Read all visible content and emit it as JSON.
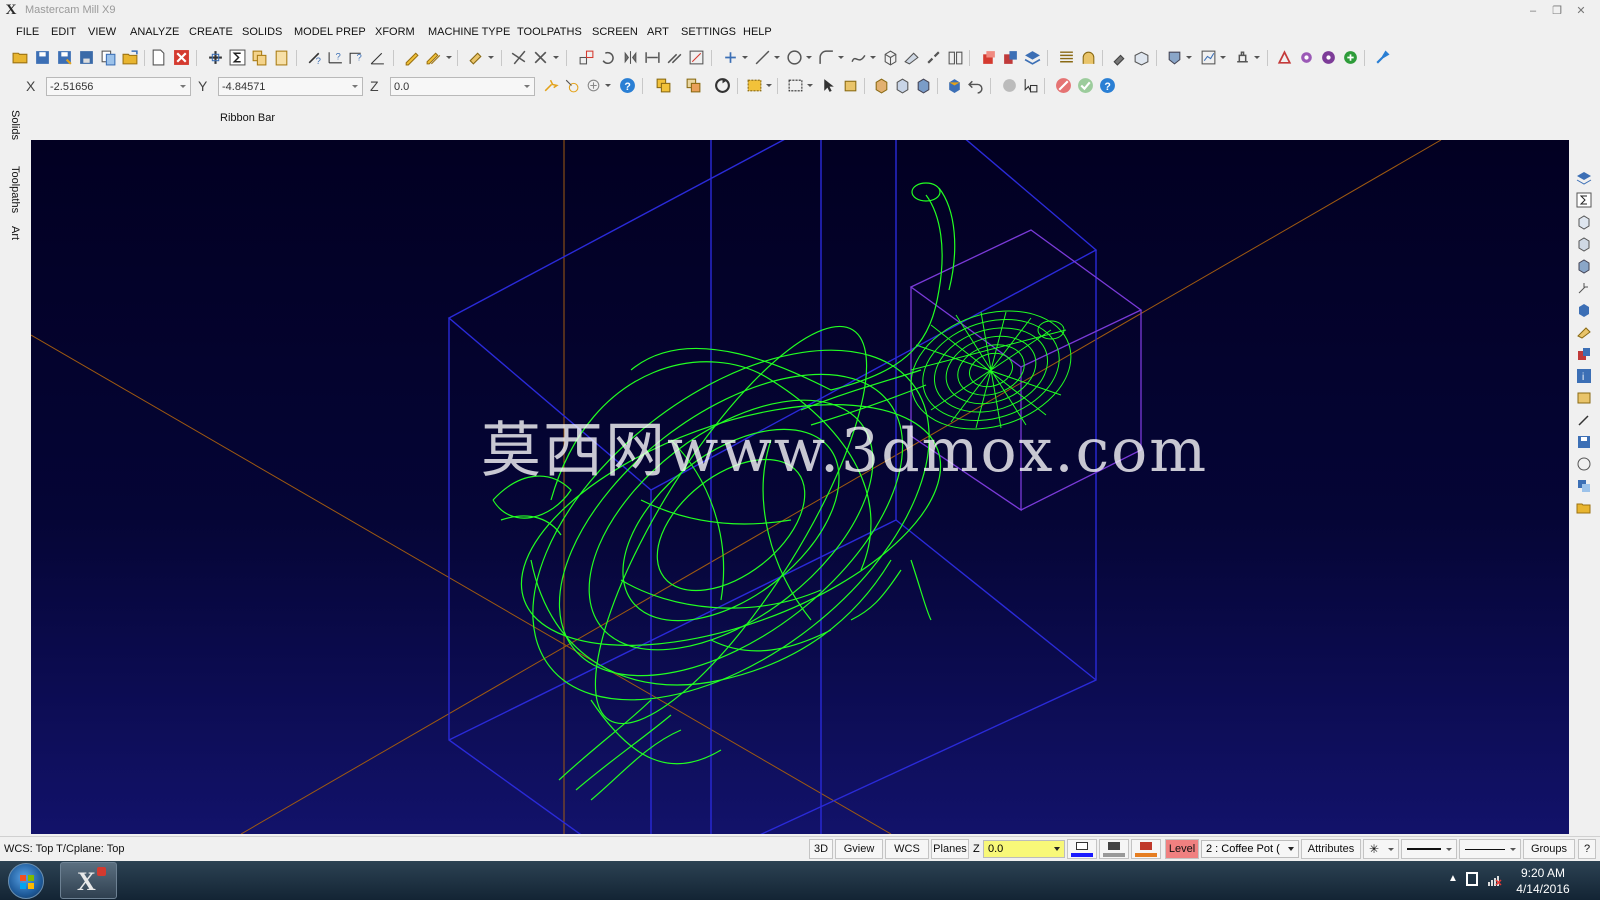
{
  "window": {
    "title": "Mastercam Mill X9"
  },
  "menu": [
    "FILE",
    "EDIT",
    "VIEW",
    "ANALYZE",
    "CREATE",
    "SOLIDS",
    "MODEL PREP",
    "XFORM",
    "MACHINE TYPE",
    "TOOLPATHS",
    "SCREEN",
    "ART",
    "SETTINGS",
    "HELP"
  ],
  "coords": {
    "x_label": "X",
    "x_value": "-2.51656",
    "y_label": "Y",
    "y_value": "-4.84571",
    "z_label": "Z",
    "z_value": "0.0"
  },
  "ribbon_label": "Ribbon Bar",
  "left_tabs": [
    "Solids",
    "Toolpaths",
    "Art"
  ],
  "viewport": {
    "watermark": "莫西网www.3dmox.com",
    "background_top": "#020022",
    "background_bottom": "#12126a",
    "wireframe_color": "#22ff22",
    "box_color": "#2a2ad8",
    "small_box_color": "#7a3ad8",
    "axis_color": "#a05a10"
  },
  "status": {
    "text": "WCS: Top  T/Cplane: Top",
    "btn_3d": "3D",
    "btn_gview": "Gview",
    "btn_wcs": "WCS",
    "btn_planes": "Planes",
    "z_label": "Z",
    "z_value": "0.0",
    "level_label": "Level",
    "level_value": "2 : Coffee Pot (",
    "attributes": "Attributes",
    "groups": "Groups",
    "help": "?"
  },
  "taskbar": {
    "time": "9:20 AM",
    "date": "4/14/2016"
  }
}
